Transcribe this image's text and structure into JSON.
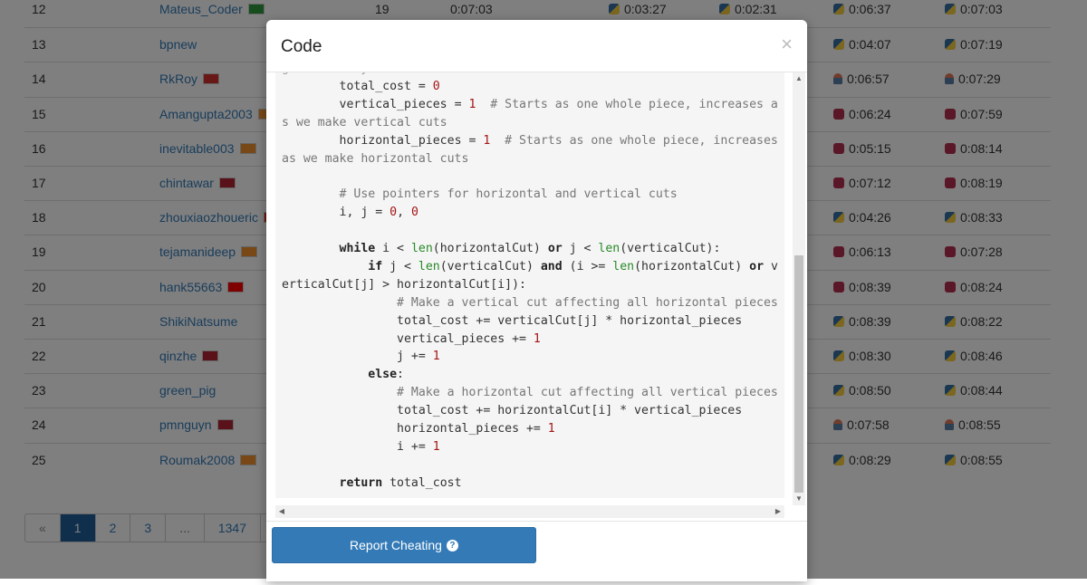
{
  "leaderboard": {
    "rows": [
      {
        "rank": "12",
        "user": "Mateus_Coder",
        "flag": "#2f9a3c",
        "score": "19",
        "total": "0:07:03",
        "q1": "0:03:27",
        "q1lang": "py",
        "q2": "0:02:31",
        "q2lang": "py",
        "q3": "0:06:37",
        "q3lang": "py",
        "q4": "0:07:03",
        "q4lang": "py"
      },
      {
        "rank": "13",
        "user": "bpnew",
        "flag": "",
        "score": "",
        "total": "",
        "q1": "",
        "q1lang": "",
        "q2": "",
        "q2lang": "",
        "q3": "0:04:07",
        "q3lang": "py",
        "q4": "0:07:19",
        "q4lang": "py"
      },
      {
        "rank": "14",
        "user": "RkRoy",
        "flag": "#d0312d",
        "score": "",
        "total": "",
        "q1": "",
        "q1lang": "",
        "q2": "",
        "q2lang": "",
        "q3": "0:06:57",
        "q3lang": "java",
        "q4": "0:07:29",
        "q4lang": "java"
      },
      {
        "rank": "15",
        "user": "Amangupta2003",
        "flag": "#f0922f",
        "score": "",
        "total": "",
        "q1": "",
        "q1lang": "",
        "q2": "",
        "q2lang": "",
        "q3": "0:06:24",
        "q3lang": "cpp",
        "q4": "0:07:59",
        "q4lang": "cpp"
      },
      {
        "rank": "16",
        "user": "inevitable003",
        "flag": "#f0922f",
        "score": "",
        "total": "",
        "q1": "",
        "q1lang": "",
        "q2": "",
        "q2lang": "",
        "q3": "0:05:15",
        "q3lang": "cpp",
        "q4": "0:08:14",
        "q4lang": "cpp"
      },
      {
        "rank": "17",
        "user": "chintawar",
        "flag": "#b22234",
        "score": "",
        "total": "",
        "q1": "",
        "q1lang": "",
        "q2": "",
        "q2lang": "",
        "q3": "0:07:12",
        "q3lang": "cpp",
        "q4": "0:08:19",
        "q4lang": "cpp"
      },
      {
        "rank": "18",
        "user": "zhouxiaozhoueric",
        "flag": "#de2910",
        "score": "",
        "total": "",
        "q1": "",
        "q1lang": "",
        "q2": "",
        "q2lang": "",
        "q3": "0:04:26",
        "q3lang": "py",
        "q4": "0:08:33",
        "q4lang": "py"
      },
      {
        "rank": "19",
        "user": "tejamanideep",
        "flag": "#f0922f",
        "score": "",
        "total": "",
        "q1": "",
        "q1lang": "",
        "q2": "",
        "q2lang": "",
        "q3": "0:06:13",
        "q3lang": "cpp",
        "q4": "0:07:28",
        "q4lang": "cpp"
      },
      {
        "rank": "20",
        "user": "hank55663",
        "flag": "#fe0000",
        "score": "",
        "total": "",
        "q1": "",
        "q1lang": "",
        "q2": "",
        "q2lang": "",
        "q3": "0:08:39",
        "q3lang": "cpp",
        "q4": "0:08:24",
        "q4lang": "cpp"
      },
      {
        "rank": "21",
        "user": "ShikiNatsume",
        "flag": "",
        "score": "",
        "total": "",
        "q1": "",
        "q1lang": "",
        "q2": "",
        "q2lang": "",
        "q3": "0:08:39",
        "q3lang": "py",
        "q4": "0:08:22",
        "q4lang": "py"
      },
      {
        "rank": "22",
        "user": "qinzhe",
        "flag": "#b22234",
        "score": "",
        "total": "",
        "q1": "",
        "q1lang": "",
        "q2": "",
        "q2lang": "",
        "q3": "0:08:30",
        "q3lang": "py",
        "q4": "0:08:46",
        "q4lang": "py"
      },
      {
        "rank": "23",
        "user": "green_pig",
        "flag": "",
        "score": "",
        "total": "",
        "q1": "",
        "q1lang": "",
        "q2": "",
        "q2lang": "",
        "q3": "0:08:50",
        "q3lang": "py",
        "q4": "0:08:44",
        "q4lang": "py"
      },
      {
        "rank": "24",
        "user": "pmnguyn",
        "flag": "#b22234",
        "score": "",
        "total": "",
        "q1": "",
        "q1lang": "",
        "q2": "",
        "q2lang": "",
        "q3": "0:07:58",
        "q3lang": "java",
        "q4": "0:08:55",
        "q4lang": "java"
      },
      {
        "rank": "25",
        "user": "Roumak2008",
        "flag": "#f0922f",
        "score": "",
        "total": "",
        "q1": "",
        "q1lang": "",
        "q2": "",
        "q2lang": "",
        "q3": "0:08:29",
        "q3lang": "py",
        "q4": "0:08:55",
        "q4lang": "py"
      }
    ]
  },
  "pagination": {
    "prev": "«",
    "pages": [
      "1",
      "2",
      "3",
      "...",
      "1347"
    ],
    "next": "»",
    "active": "1"
  },
  "modal": {
    "title": "Code",
    "close": "×",
    "report_label": "Report Cheating",
    "help_glyph": "?"
  },
  "code": {
    "lines": [
      [
        {
          "t": "generated by cuts",
          "c": "dim"
        }
      ],
      [
        {
          "t": "        total_cost = "
        },
        {
          "t": "0",
          "c": "num"
        }
      ],
      [
        {
          "t": "        vertical_pieces = "
        },
        {
          "t": "1",
          "c": "num"
        },
        {
          "t": "  # Starts as one whole piece, increases as we make vertical cuts",
          "c": "cmt"
        }
      ],
      [
        {
          "t": "        horizontal_pieces = "
        },
        {
          "t": "1",
          "c": "num"
        },
        {
          "t": "  # Starts as one whole piece, increases as we make horizontal cuts",
          "c": "cmt"
        }
      ],
      [
        {
          "t": ""
        }
      ],
      [
        {
          "t": "        # Use pointers for horizontal and vertical cuts",
          "c": "cmt"
        }
      ],
      [
        {
          "t": "        i, j = "
        },
        {
          "t": "0",
          "c": "num"
        },
        {
          "t": ", "
        },
        {
          "t": "0",
          "c": "num"
        }
      ],
      [
        {
          "t": ""
        }
      ],
      [
        {
          "t": "        "
        },
        {
          "t": "while",
          "c": "kw"
        },
        {
          "t": " i < "
        },
        {
          "t": "len",
          "c": "fn"
        },
        {
          "t": "(horizontalCut) "
        },
        {
          "t": "or",
          "c": "kw"
        },
        {
          "t": " j < "
        },
        {
          "t": "len",
          "c": "fn"
        },
        {
          "t": "(verticalCut):"
        }
      ],
      [
        {
          "t": "            "
        },
        {
          "t": "if",
          "c": "kw"
        },
        {
          "t": " j < "
        },
        {
          "t": "len",
          "c": "fn"
        },
        {
          "t": "(verticalCut) "
        },
        {
          "t": "and",
          "c": "kw"
        },
        {
          "t": " (i >= "
        },
        {
          "t": "len",
          "c": "fn"
        },
        {
          "t": "(horizontalCut) "
        },
        {
          "t": "or",
          "c": "kw"
        },
        {
          "t": " verticalCut[j] > horizontalCut[i]):"
        }
      ],
      [
        {
          "t": "                # Make a vertical cut affecting all horizontal pieces",
          "c": "cmt"
        }
      ],
      [
        {
          "t": "                total_cost += verticalCut[j] * horizontal_pieces"
        }
      ],
      [
        {
          "t": "                vertical_pieces += "
        },
        {
          "t": "1",
          "c": "num"
        }
      ],
      [
        {
          "t": "                j += "
        },
        {
          "t": "1",
          "c": "num"
        }
      ],
      [
        {
          "t": "            "
        },
        {
          "t": "else",
          "c": "kw"
        },
        {
          "t": ":"
        }
      ],
      [
        {
          "t": "                # Make a horizontal cut affecting all vertical pieces",
          "c": "cmt"
        }
      ],
      [
        {
          "t": "                total_cost += horizontalCut[i] * vertical_pieces"
        }
      ],
      [
        {
          "t": "                horizontal_pieces += "
        },
        {
          "t": "1",
          "c": "num"
        }
      ],
      [
        {
          "t": "                i += "
        },
        {
          "t": "1",
          "c": "num"
        }
      ],
      [
        {
          "t": ""
        }
      ],
      [
        {
          "t": "        "
        },
        {
          "t": "return",
          "c": "kw"
        },
        {
          "t": " total_cost"
        }
      ]
    ]
  },
  "scrollbar": {
    "up": "▲",
    "down": "▼",
    "left": "◀",
    "right": "▶"
  }
}
